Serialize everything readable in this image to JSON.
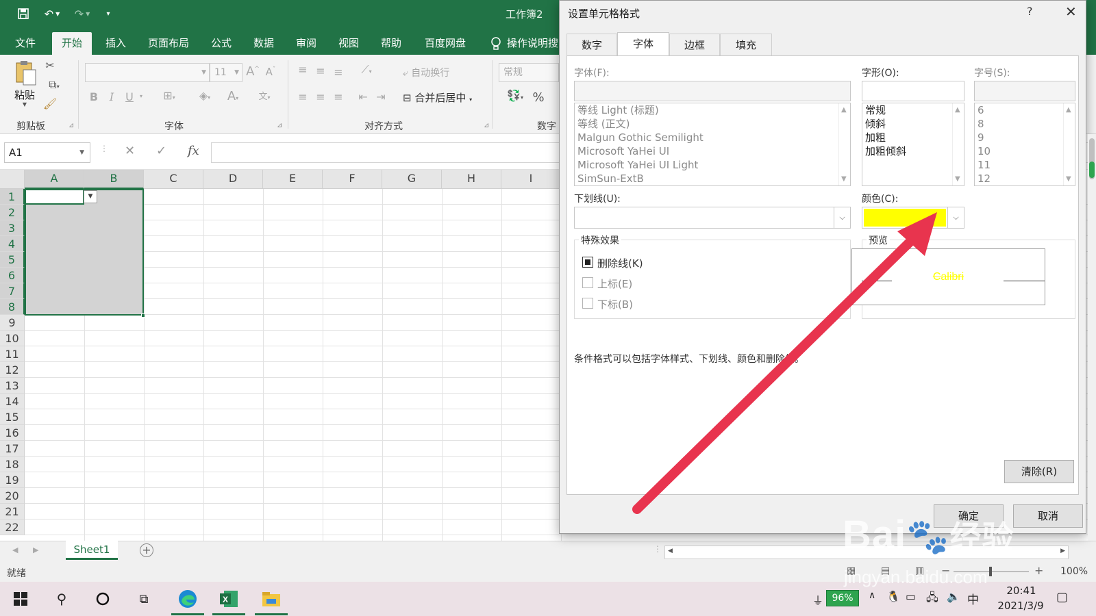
{
  "app": {
    "workbook_title": "工作簿2",
    "tabs": [
      "文件",
      "开始",
      "插入",
      "页面布局",
      "公式",
      "数据",
      "审阅",
      "视图",
      "帮助",
      "百度网盘"
    ],
    "tell_me": "操作说明搜"
  },
  "ribbon": {
    "paste_label": "粘贴",
    "clipboard_group": "剪贴板",
    "font_group": "字体",
    "align_group": "对齐方式",
    "number_group": "数字",
    "font_size": "11",
    "wrap_text": "自动换行",
    "merge_center": "合并后居中",
    "number_format": "常规",
    "bold": "B",
    "italic": "I",
    "underline": "U",
    "percent": "%"
  },
  "formula_bar": {
    "name_box": "A1",
    "fx": "fx"
  },
  "grid": {
    "columns": [
      "A",
      "B",
      "C",
      "D",
      "E",
      "F",
      "G",
      "H",
      "I"
    ],
    "rows": [
      "1",
      "2",
      "3",
      "4",
      "5",
      "6",
      "7",
      "8",
      "9",
      "10",
      "11",
      "12",
      "13",
      "14",
      "15",
      "16",
      "17",
      "18",
      "19",
      "20",
      "21",
      "22"
    ]
  },
  "sheets": {
    "active": "Sheet1"
  },
  "status": {
    "ready": "就绪",
    "zoom": "100%"
  },
  "taskbar": {
    "battery": "96%",
    "ime": "中",
    "time": "20:41",
    "date": "2021/3/9"
  },
  "dialog": {
    "title": "设置单元格格式",
    "help": "?",
    "tabs": [
      "数字",
      "字体",
      "边框",
      "填充"
    ],
    "active_tab": "字体",
    "font_label": "字体(F):",
    "font_options": [
      "等线 Light (标题)",
      "等线 (正文)",
      "Malgun Gothic Semilight",
      "Microsoft YaHei UI",
      "Microsoft YaHei UI Light",
      "SimSun-ExtB"
    ],
    "style_label": "字形(O):",
    "style_options": [
      "常规",
      "倾斜",
      "加粗",
      "加粗倾斜"
    ],
    "size_label": "字号(S):",
    "size_options": [
      "6",
      "8",
      "9",
      "10",
      "11",
      "12"
    ],
    "underline_label": "下划线(U):",
    "color_label": "颜色(C):",
    "selected_color": "#FFFF00",
    "effects_label": "特殊效果",
    "strikethrough": "删除线(K)",
    "superscript": "上标(E)",
    "subscript": "下标(B)",
    "preview_label": "预览",
    "preview_text": "Calibri",
    "note": "条件格式可以包括字体样式、下划线、颜色和删除线。",
    "clear_button": "清除(R)",
    "ok_button": "确定",
    "cancel_button": "取消"
  },
  "watermark": {
    "brand": "Bai",
    "brand_tail": "经验",
    "url": "jingyan.baidu.com"
  },
  "colors": {
    "excel_green": "#217346",
    "annotation_red": "#E8344E",
    "preview_yellow": "#FFFF00"
  }
}
